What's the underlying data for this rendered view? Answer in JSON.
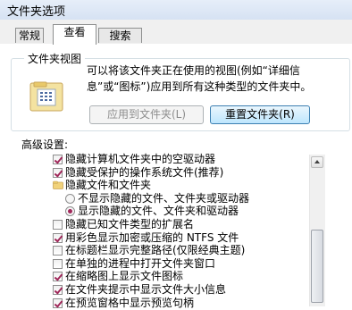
{
  "window": {
    "title": "文件夹选项"
  },
  "tabs": [
    {
      "label": "常规"
    },
    {
      "label": "查看"
    },
    {
      "label": "搜索"
    }
  ],
  "folder_view": {
    "legend": "文件夹视图",
    "description": "可以将该文件夹正在使用的视图(例如“详细信息”或“图标”)应用到所有这种类型的文件夹中。",
    "apply_button": "应用到文件夹(L)",
    "reset_button": "重置文件夹(R)"
  },
  "advanced": {
    "label": "高级设置:",
    "items": [
      {
        "kind": "checkbox",
        "checked": true,
        "indent": 0,
        "label": "隐藏计算机文件夹中的空驱动器"
      },
      {
        "kind": "checkbox",
        "checked": true,
        "indent": 0,
        "label": "隐藏受保护的操作系统文件(推荐)"
      },
      {
        "kind": "folder",
        "indent": 0,
        "label": "隐藏文件和文件夹"
      },
      {
        "kind": "radio",
        "selected": false,
        "indent": 1,
        "label": "不显示隐藏的文件、文件夹或驱动器"
      },
      {
        "kind": "radio",
        "selected": true,
        "indent": 1,
        "label": "显示隐藏的文件、文件夹和驱动器"
      },
      {
        "kind": "checkbox",
        "checked": false,
        "indent": 0,
        "label": "隐藏已知文件类型的扩展名"
      },
      {
        "kind": "checkbox",
        "checked": true,
        "indent": 0,
        "label": "用彩色显示加密或压缩的 NTFS 文件"
      },
      {
        "kind": "checkbox",
        "checked": false,
        "indent": 0,
        "label": "在标题栏显示完整路径(仅限经典主题)"
      },
      {
        "kind": "checkbox",
        "checked": false,
        "indent": 0,
        "label": "在单独的进程中打开文件夹窗口"
      },
      {
        "kind": "checkbox",
        "checked": true,
        "indent": 0,
        "label": "在缩略图上显示文件图标"
      },
      {
        "kind": "checkbox",
        "checked": true,
        "indent": 0,
        "label": "在文件夹提示中显示文件大小信息"
      },
      {
        "kind": "checkbox",
        "checked": true,
        "indent": 0,
        "label": "在预览窗格中显示预览句柄"
      }
    ]
  },
  "colors": {
    "check": "#a0285a",
    "tab_border": "#8e8f8f"
  },
  "icons": {
    "folder_view": "folder-options-icon",
    "tree_folder": "folder-icon"
  }
}
